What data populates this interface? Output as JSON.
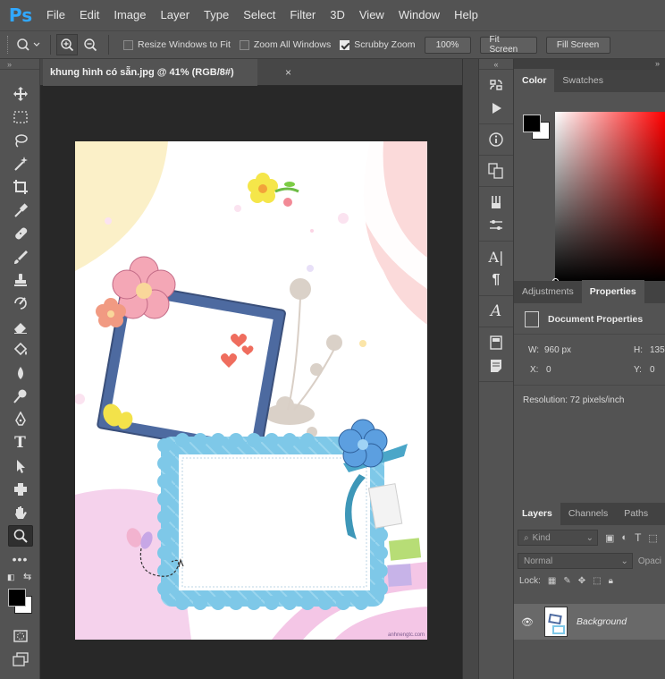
{
  "app": {
    "logo": "Ps"
  },
  "menu": [
    "File",
    "Edit",
    "Image",
    "Layer",
    "Type",
    "Select",
    "Filter",
    "3D",
    "View",
    "Window",
    "Help"
  ],
  "options": {
    "resize_windows": {
      "label": "Resize Windows to Fit",
      "checked": false
    },
    "zoom_all": {
      "label": "Zoom All Windows",
      "checked": false
    },
    "scrubby_zoom": {
      "label": "Scrubby Zoom",
      "checked": true
    },
    "zoom_percent": "100%",
    "fit_screen": "Fit Screen",
    "fill_screen": "Fill Screen"
  },
  "document": {
    "tab_title": "khung hình có sẵn.jpg @ 41% (RGB/8#)",
    "close": "×",
    "watermark": "anhnengtc.com"
  },
  "panels": {
    "color_tabs": [
      "Color",
      "Swatches"
    ],
    "props_tabs": [
      "Adjustments",
      "Properties"
    ],
    "doc_props_title": "Document Properties",
    "w_label": "W:",
    "w_value": "960 px",
    "h_label": "H:",
    "h_value": "135",
    "x_label": "X:",
    "x_value": "0",
    "y_label": "Y:",
    "y_value": "0",
    "resolution": "Resolution: 72 pixels/inch",
    "layers_tabs": [
      "Layers",
      "Channels",
      "Paths"
    ],
    "kind": "Kind",
    "blend_mode": "Normal",
    "opacity": "Opaci",
    "lock": "Lock:",
    "layer_name": "Background"
  },
  "colors": {
    "accent": "#31a8ff",
    "ui_bg": "#535353",
    "canvas_bg": "#282828",
    "foreground": "#000000",
    "background": "#ffffff",
    "hue": "#ff0000"
  }
}
